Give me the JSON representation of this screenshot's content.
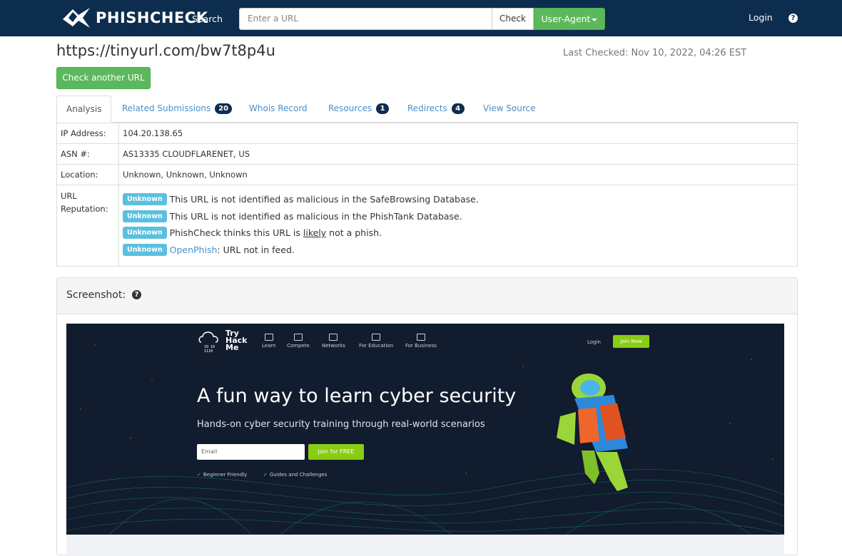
{
  "nav": {
    "brand": "PHISHCHECK",
    "search_label": "Search",
    "url_placeholder": "Enter a URL",
    "check_label": "Check",
    "user_agent_label": "User-Agent",
    "login_label": "Login",
    "help_glyph": "?"
  },
  "header": {
    "url": "https://tinyurl.com/bw7t8p4u",
    "last_checked": "Last Checked: Nov 10, 2022, 04:26 EST",
    "check_another_label": "Check another URL"
  },
  "tabs": [
    {
      "label": "Analysis",
      "badge": null,
      "active": true
    },
    {
      "label": "Related Submissions",
      "badge": "20",
      "active": false
    },
    {
      "label": "Whois Record",
      "badge": null,
      "active": false
    },
    {
      "label": "Resources",
      "badge": "1",
      "active": false
    },
    {
      "label": "Redirects",
      "badge": "4",
      "active": false
    },
    {
      "label": "View Source",
      "badge": null,
      "active": false
    }
  ],
  "info": {
    "ip_label": "IP Address:",
    "ip_value": "104.20.138.65",
    "asn_label": "ASN #:",
    "asn_value": "AS13335 CLOUDFLARENET, US",
    "location_label": "Location:",
    "location_value": "Unknown, Unknown, Unknown",
    "reputation_label": "URL Reputation:",
    "reputation": [
      {
        "tag": "Unknown",
        "text": "This URL is not identified as malicious in the SafeBrowsing Database."
      },
      {
        "tag": "Unknown",
        "text": "This URL is not identified as malicious in the PhishTank Database."
      },
      {
        "tag": "Unknown",
        "text_before": "PhishCheck thinks this URL is ",
        "text_underline": "likely",
        "text_after": " not a phish."
      },
      {
        "tag": "Unknown",
        "link": "OpenPhish",
        "text": ": URL not in feed."
      }
    ]
  },
  "screenshot": {
    "title": "Screenshot:",
    "help_glyph": "?",
    "site": {
      "logo_lines": [
        "Try",
        "Hack",
        "Me"
      ],
      "nav_items": [
        "Learn",
        "Compete",
        "Networks",
        "For Education",
        "For Business"
      ],
      "login": "Login",
      "join": "Join Now",
      "headline": "A fun way to learn cyber security",
      "subheadline": "Hands-on cyber security training through real-world scenarios",
      "email_placeholder": "Email",
      "join_free": "Join for FREE",
      "features": [
        "Beginner Friendly",
        "Guides and Challenges"
      ]
    }
  },
  "colors": {
    "navbar": "#0d2d4e",
    "success": "#5cb85c",
    "info_tag": "#5bc0de",
    "link": "#4a90c9",
    "thm_green": "#88cc14"
  }
}
